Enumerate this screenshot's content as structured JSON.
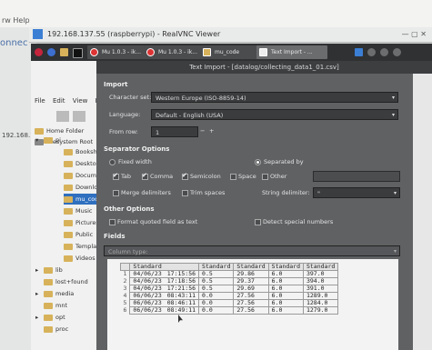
{
  "host": {
    "menu_label": "rw   Help",
    "left_fragment": "onnec",
    "ip_fragment": "192.168.13"
  },
  "vnc": {
    "title": "192.168.137.55 (raspberrypi) - RealVNC Viewer"
  },
  "taskbar": {
    "buttons": [
      {
        "label": "Mu 1.0.3 - ik..."
      },
      {
        "label": "Mu 1.0.3 - ik..."
      },
      {
        "label": "mu_code"
      },
      {
        "label": "Text Import - ..."
      }
    ]
  },
  "file_manager": {
    "menu": [
      "File",
      "Edit",
      "View",
      "B"
    ],
    "location_row": "Home Folder",
    "filesystem_row": "Filesystem Root",
    "tree": [
      {
        "label": "pi",
        "expander": "▾"
      },
      {
        "label": "Bookshelf"
      },
      {
        "label": "Desktop"
      },
      {
        "label": "Documents"
      },
      {
        "label": "Downloads"
      },
      {
        "label": "mu_code",
        "selected": true
      },
      {
        "label": "Music"
      },
      {
        "label": "Pictures"
      },
      {
        "label": "Public"
      },
      {
        "label": "Templates"
      },
      {
        "label": "Videos"
      },
      {
        "label": "lib",
        "expander": "▸"
      },
      {
        "label": "lost+found"
      },
      {
        "label": "media",
        "expander": "▸"
      },
      {
        "label": "mnt"
      },
      {
        "label": "opt",
        "expander": "▸"
      },
      {
        "label": "proc"
      }
    ]
  },
  "dialog": {
    "title": "Text Import - [datalog/collecting_data1_01.csv]",
    "import_header": "Import",
    "charset_label": "Character set:",
    "charset_value": "Western Europe (ISO-8859-14)",
    "language_label": "Language:",
    "language_value": "Default - English (USA)",
    "fromrow_label": "From row:",
    "fromrow_value": "1",
    "fromrow_minus": "−",
    "fromrow_plus": "+",
    "separator_header": "Separator Options",
    "fixed_width": "Fixed width",
    "separated_by": "Separated by",
    "tab": "Tab",
    "comma": "Comma",
    "semicolon": "Semicolon",
    "space": "Space",
    "other": "Other",
    "merge_delimiters": "Merge delimiters",
    "trim_spaces": "Trim spaces",
    "string_delimiter_label": "String delimiter:",
    "string_delimiter_value": "\"",
    "other_options_header": "Other Options",
    "format_quoted": "Format quoted field as text",
    "detect_special": "Detect special numbers",
    "fields_header": "Fields",
    "column_type_label": "Column type:"
  },
  "preview": {
    "headers": [
      "Standard",
      "Standard",
      "Standard",
      "Standard",
      "Standard"
    ],
    "rows": [
      [
        "04/06/23",
        "17:15:56",
        "0.5",
        "29.86",
        "6.0",
        "397.0"
      ],
      [
        "04/06/23",
        "17:18:56",
        "0.5",
        "29.37",
        "6.0",
        "394.0"
      ],
      [
        "04/06/23",
        "17:21:56",
        "0.5",
        "29.69",
        "6.0",
        "391.0"
      ],
      [
        "06/06/23",
        "08:43:11",
        "0.0",
        "27.56",
        "6.0",
        "1289.0"
      ],
      [
        "06/06/23",
        "08:46:11",
        "0.0",
        "27.56",
        "6.0",
        "1284.0"
      ],
      [
        "06/06/23",
        "08:49:11",
        "0.0",
        "27.56",
        "6.0",
        "1279.0"
      ]
    ],
    "row_numbers": [
      "1",
      "2",
      "3",
      "4",
      "5",
      "6"
    ]
  },
  "colors": {
    "dialog_bg": "#5f6163",
    "taskbar_bg": "#2f3133",
    "selection": "#2f6fbf"
  }
}
